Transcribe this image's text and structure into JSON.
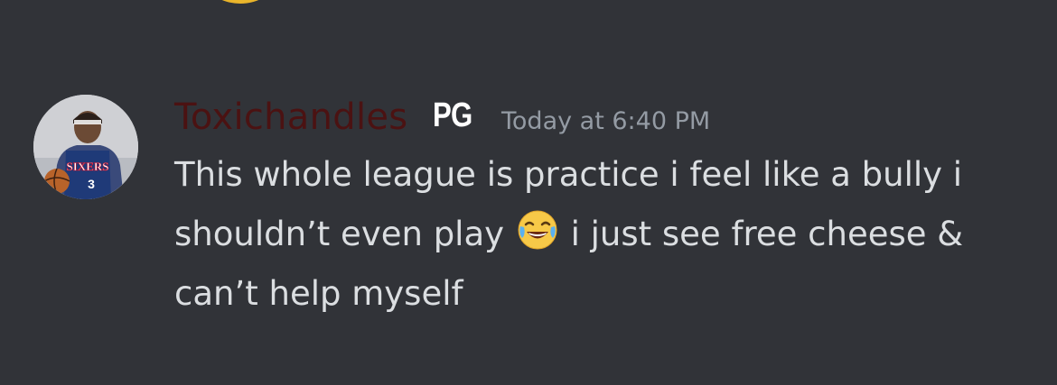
{
  "message": {
    "author": "Toxichandles",
    "author_color": "#4b1212",
    "tag": "PG",
    "timestamp": "Today at 6:40 PM",
    "content": {
      "line1": "This whole league is practice i feel like a bully i",
      "line2_before": "shouldn’t even play",
      "emoji": "joy-emoji",
      "line2_after": "i just see free cheese &",
      "line3": "can’t help myself"
    },
    "avatar": {
      "jersey_text": "SIXERS",
      "jersey_number": "3"
    }
  },
  "theme": {
    "background": "#313338",
    "text": "#dbdee1",
    "muted": "#949ba4"
  }
}
